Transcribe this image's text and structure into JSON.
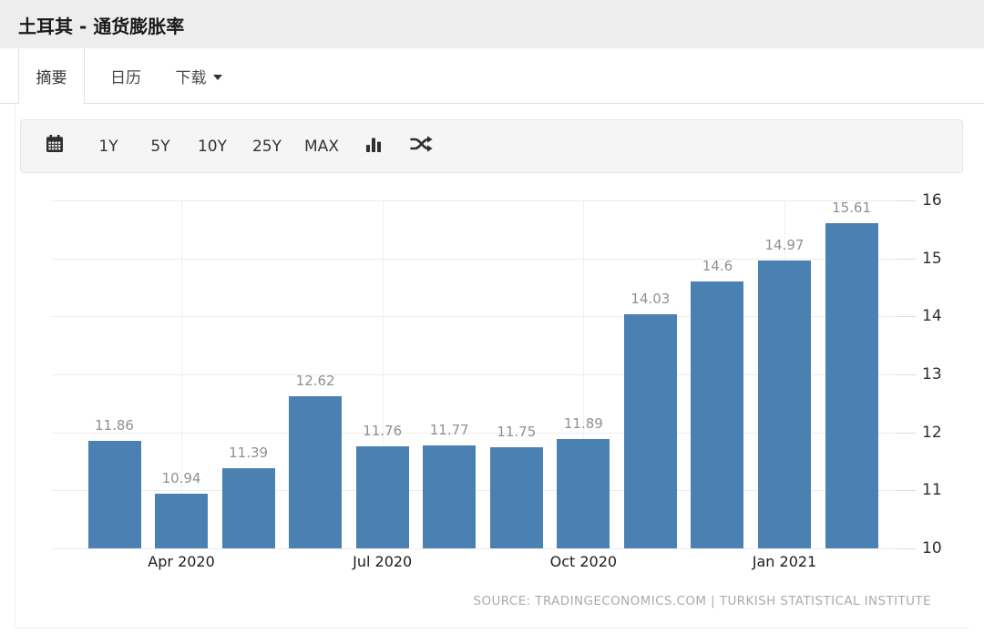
{
  "header": {
    "title": "土耳其 - 通货膨胀率"
  },
  "tabs": [
    {
      "label": "摘要",
      "active": true
    },
    {
      "label": "日历",
      "active": false
    },
    {
      "label": "下载",
      "active": false,
      "has_caret": true
    }
  ],
  "toolbar": {
    "calendar_icon": "calendar-icon",
    "ranges": [
      "1Y",
      "5Y",
      "10Y",
      "25Y",
      "MAX"
    ],
    "bar_chart_icon": "bar-chart-icon",
    "shuffle_icon": "shuffle-icon"
  },
  "colors": {
    "bar": "#4a81b2",
    "header_bg": "#ededed",
    "toolbar_bg": "#f5f5f5",
    "value_label": "#909090",
    "gridline": "#ececec"
  },
  "chart_data": {
    "type": "bar",
    "title": "土耳其 - 通货膨胀率 (Turkey inflation rate, %)",
    "values": [
      11.86,
      10.94,
      11.39,
      12.62,
      11.76,
      11.77,
      11.75,
      11.89,
      14.03,
      14.6,
      14.97,
      15.61
    ],
    "bar_labels": [
      "11.86",
      "10.94",
      "11.39",
      "12.62",
      "11.76",
      "11.77",
      "11.75",
      "11.89",
      "14.03",
      "14.6",
      "14.97",
      "15.61"
    ],
    "x_tick_labels": [
      "Apr 2020",
      "Jul 2020",
      "Oct 2020",
      "Jan 2021"
    ],
    "x_tick_bar_indexes": [
      1,
      4,
      7,
      10
    ],
    "y_ticks": [
      10,
      11,
      12,
      13,
      14,
      15,
      16
    ],
    "ylim": [
      10,
      16.35
    ],
    "grid": true,
    "legend": "none",
    "y_axis_side": "right",
    "bar_color": "#4a81b2",
    "source": "SOURCE: TRADINGECONOMICS.COM | TURKISH STATISTICAL INSTITUTE"
  }
}
